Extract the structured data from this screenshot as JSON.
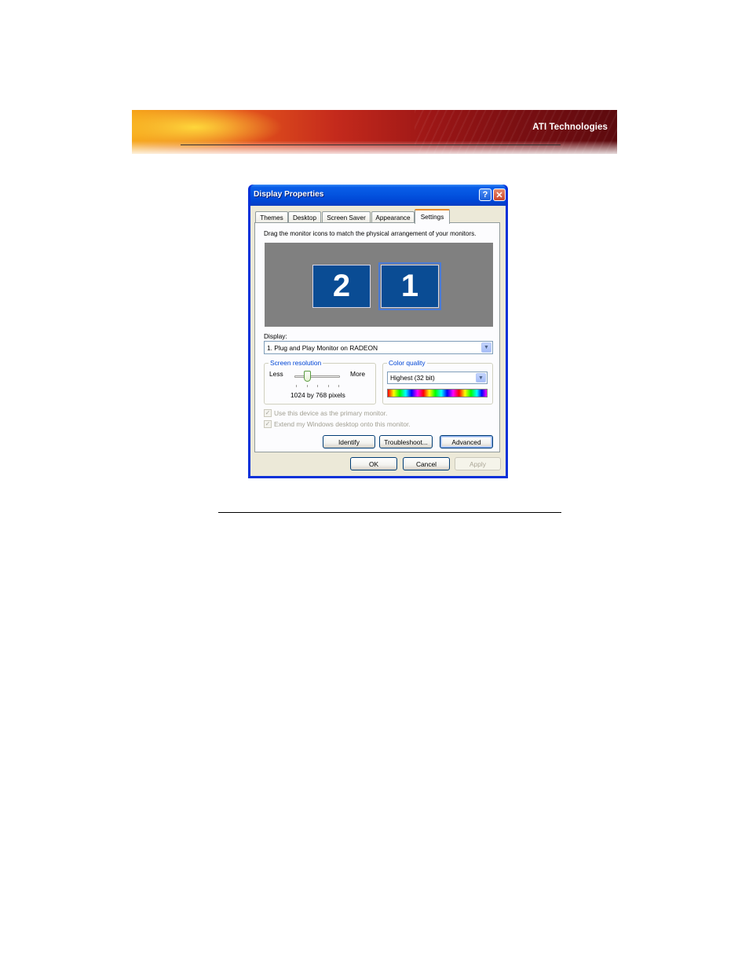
{
  "banner": {
    "brand": "ATI Technologies"
  },
  "dialog": {
    "title": "Display Properties",
    "help_glyph": "?",
    "close_glyph": "✕",
    "tabs": [
      "Themes",
      "Desktop",
      "Screen Saver",
      "Appearance",
      "Settings"
    ],
    "active_tab": "Settings",
    "instruction": "Drag the monitor icons to match the physical arrangement of your monitors.",
    "monitors": [
      {
        "number": "2",
        "selected": false
      },
      {
        "number": "1",
        "selected": true
      }
    ],
    "display_label": "Display:",
    "display_value": "1. Plug and Play Monitor on RADEON",
    "screen_resolution": {
      "legend": "Screen resolution",
      "less_label": "Less",
      "more_label": "More",
      "value_text": "1024 by 768 pixels",
      "slider_level": 0.3
    },
    "color_quality": {
      "legend": "Color quality",
      "value": "Highest (32 bit)"
    },
    "checkboxes": [
      {
        "label": "Use this device as the primary monitor.",
        "checked": true,
        "enabled": false
      },
      {
        "label": "Extend my Windows desktop onto this monitor.",
        "checked": true,
        "enabled": false
      }
    ],
    "panel_buttons": {
      "identify": "Identify",
      "troubleshoot": "Troubleshoot...",
      "advanced": "Advanced"
    },
    "footer_buttons": {
      "ok": "OK",
      "cancel": "Cancel",
      "apply": "Apply"
    },
    "check_glyph": "✓",
    "dropdown_glyph": "▼"
  }
}
